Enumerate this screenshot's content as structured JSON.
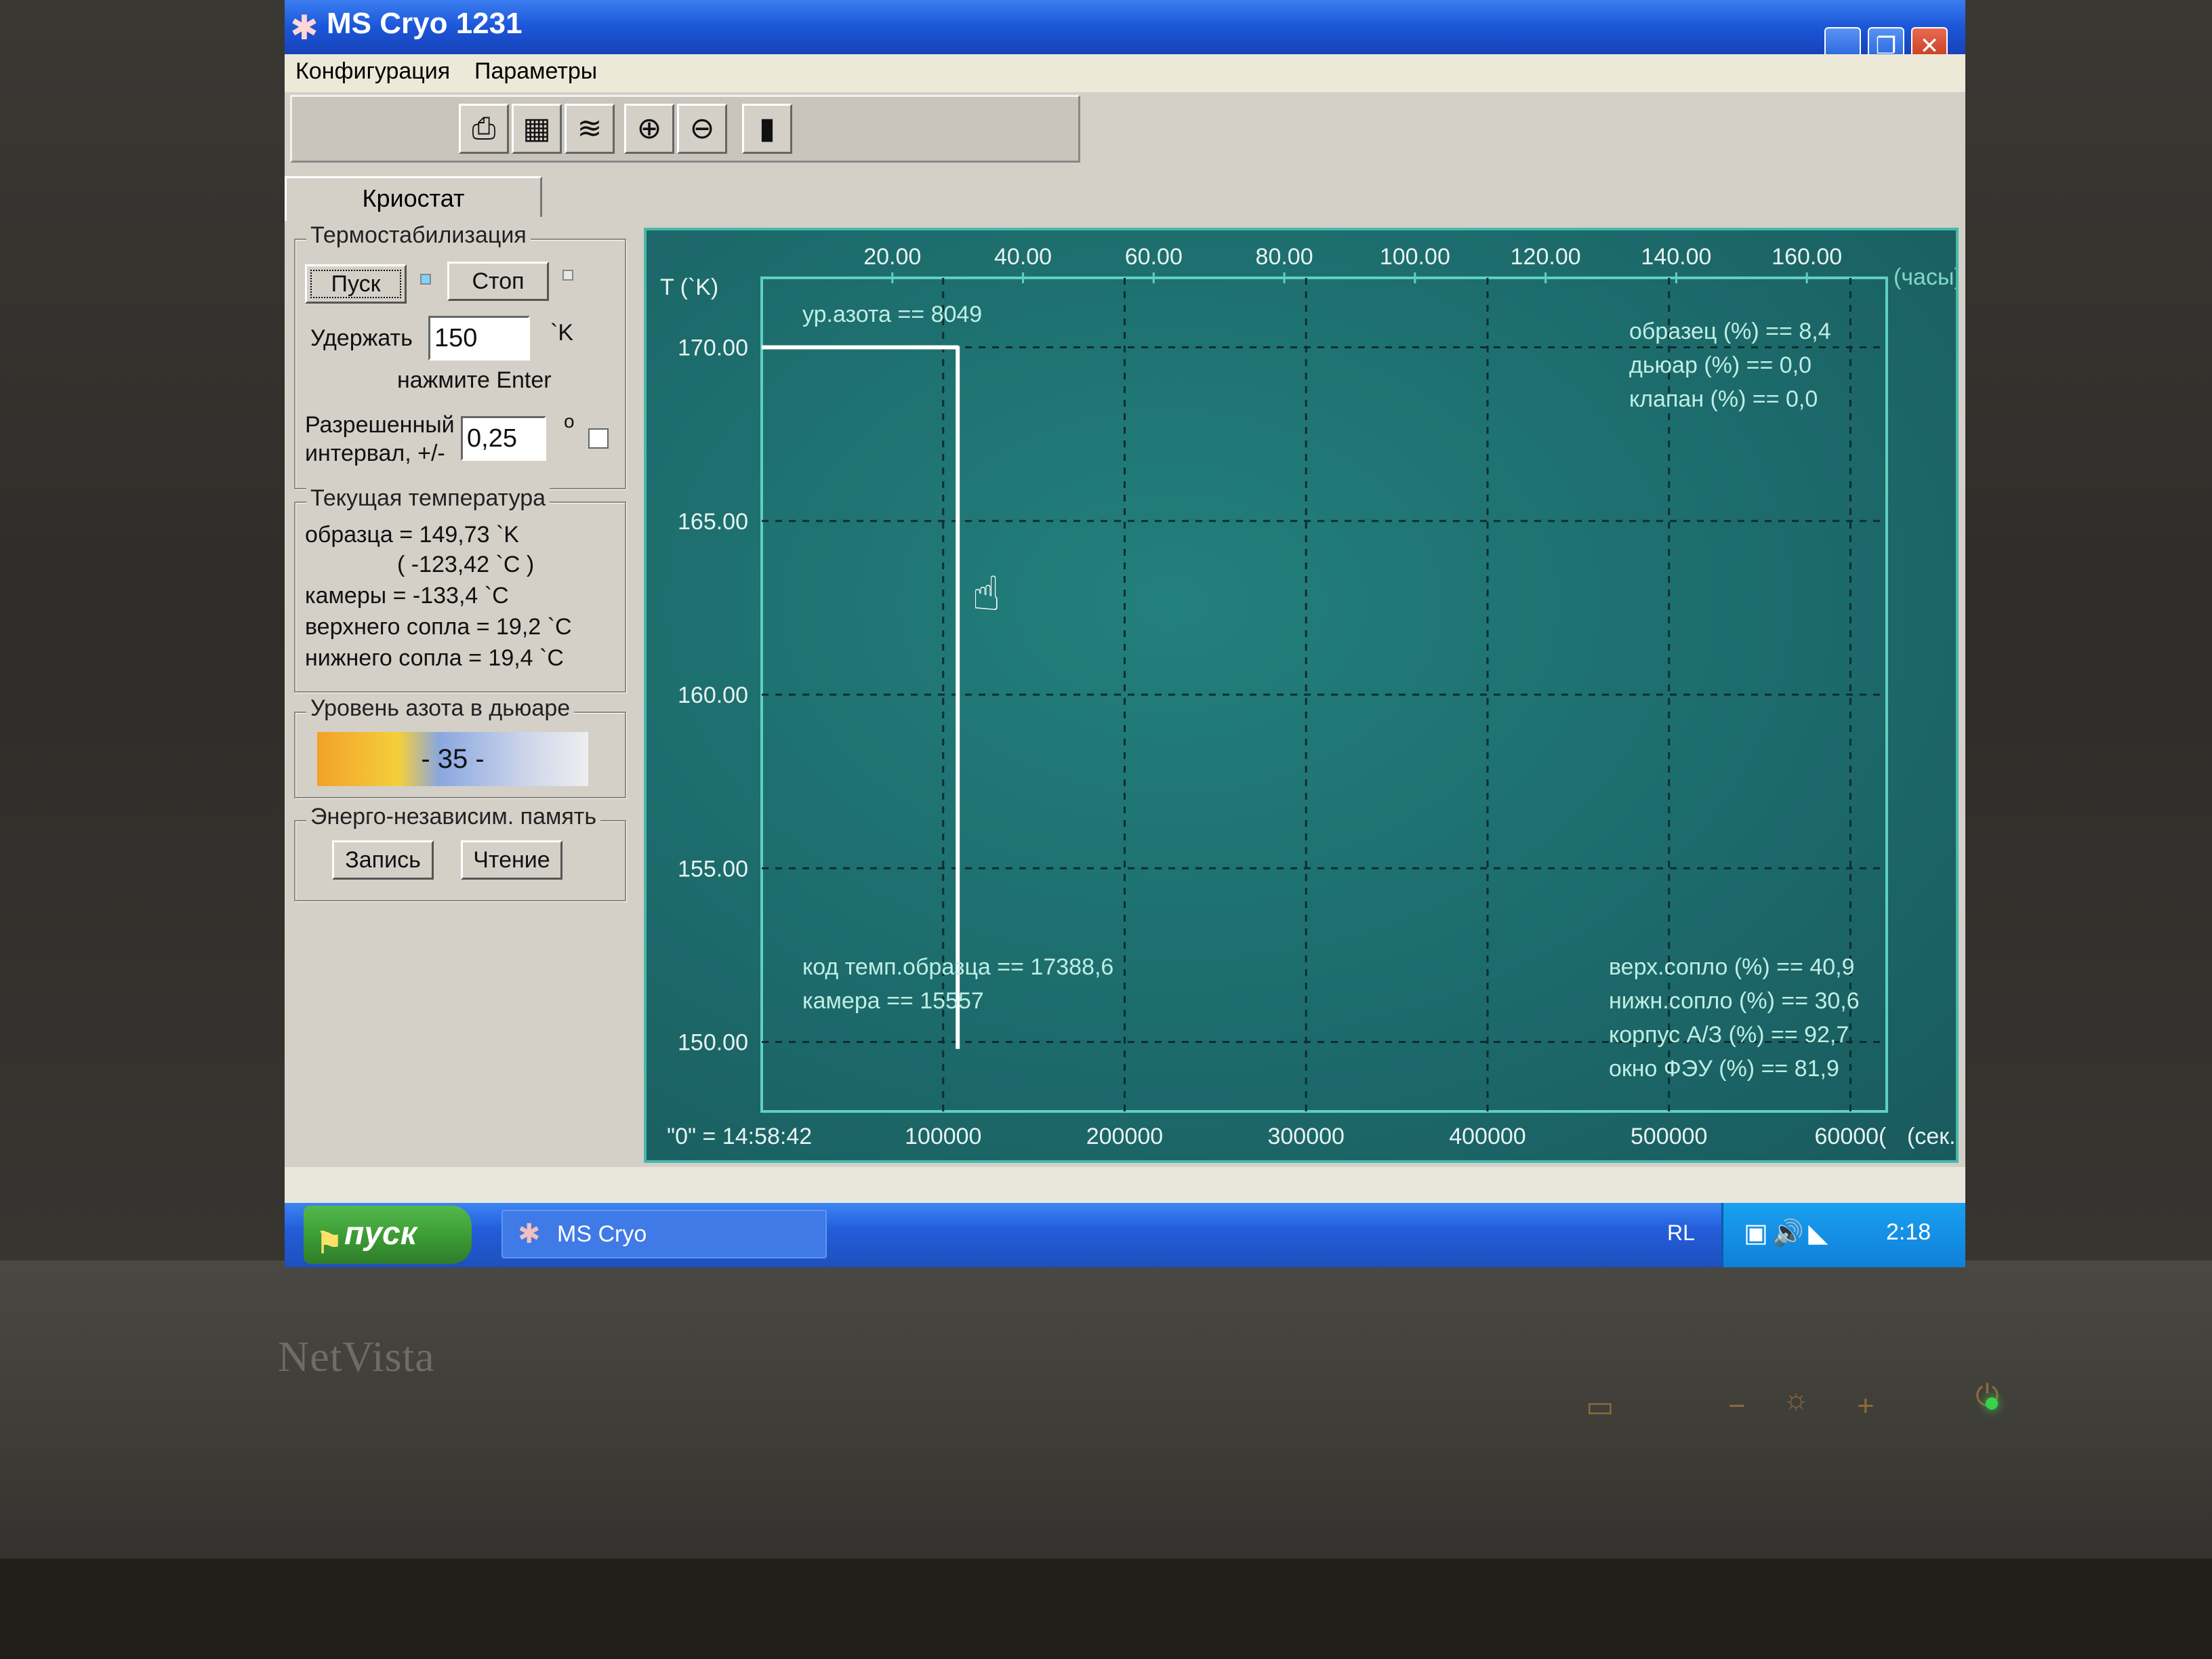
{
  "window": {
    "title": "MS Cryo 1231"
  },
  "menu": [
    "Конфигурация",
    "Параметры"
  ],
  "toolbar": [
    "print-icon",
    "table-icon",
    "chart-icon",
    "zoom-in-icon",
    "zoom-out-icon",
    "exit-icon"
  ],
  "tab": "Криостат",
  "thermo": {
    "title": "Термостабилизация",
    "start": "Пуск",
    "stop": "Стоп",
    "hold_label": "Удержать",
    "hold_value": "150",
    "hold_unit": "`K",
    "enter_hint": "нажмите Enter",
    "range_label1": "Разрешенный",
    "range_label2": "интервал, +/-",
    "range_value": "0,25",
    "range_unit": "o"
  },
  "current": {
    "title": "Текущая температура",
    "sample": "образца = 149,73 `K",
    "sample_c": "( -123,42 `C )",
    "chamber": "камеры =  -133,4 `C",
    "upper": "верхнего сопла = 19,2 `C",
    "lower": "нижнего сопла  = 19,4 `C"
  },
  "nitrogen": {
    "title": "Уровень азота в дьюаре",
    "level": "- 35 -"
  },
  "memory": {
    "title": "Энерго-независим. память",
    "write": "Запись",
    "read": "Чтение"
  },
  "chart_data": {
    "type": "line",
    "ylabel": "T (`K)",
    "y_ticks": [
      "170.00",
      "165.00",
      "160.00",
      "155.00",
      "150.00"
    ],
    "ylim": [
      148,
      172
    ],
    "top_ticks": [
      "20.00",
      "40.00",
      "60.00",
      "80.00",
      "100.00",
      "120.00",
      "140.00",
      "160.00"
    ],
    "top_unit": "(часы)",
    "bottom_ticks": [
      "100000",
      "200000",
      "300000",
      "400000",
      "500000",
      "60000("
    ],
    "bottom_unit": "(сек.)",
    "zero_label": "\"0\" = 14:58:42",
    "xlim": [
      0,
      620000
    ],
    "series": [
      {
        "x": [
          0,
          108000,
          108000
        ],
        "y": [
          170.0,
          170.0,
          149.8
        ]
      }
    ],
    "annotations": {
      "n2_level": "ур.азота == 8049",
      "sample_pct": "образец (%) == 8,4",
      "dewar_pct": "дьюар (%) == 0,0",
      "valve_pct": "клапан (%) == 0,0",
      "code_sample": "код темп.образца == 17388,6",
      "chamber_code": "камера    == 15557",
      "upper_nozzle": "верх.сопло (%) == 40,9",
      "lower_nozzle": "нижн.сопло (%) == 30,6",
      "housing": "корпус А/З (%) == 92,7",
      "pmt_window": "окно ФЭУ (%) == 81,9"
    }
  },
  "taskbar": {
    "start": "пуск",
    "task": "MS Cryo",
    "lang": "RL",
    "clock": "2:18"
  },
  "monitor": {
    "brand": "NetVista"
  }
}
